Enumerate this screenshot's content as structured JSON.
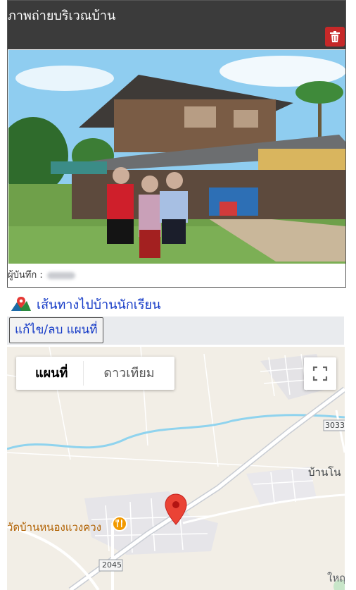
{
  "panel": {
    "title": "ภาพถ่ายบริเวณบ้าน",
    "delete_icon": "trash-icon",
    "recorder_label": "ผู้บันทึก :"
  },
  "route": {
    "icon": "map-pin-icon",
    "link_text": "เส้นทางไปบ้านนักเรียน"
  },
  "edit_map_button": "แก้ไข/ลบ แผนที่",
  "map": {
    "tabs": [
      {
        "label": "แผนที่",
        "active": true
      },
      {
        "label": "ดาวเทียม",
        "active": false
      }
    ],
    "fullscreen_icon": "fullscreen-icon",
    "road_badge_3033": "3033",
    "road_badge_2045": "2045",
    "village_label": "บ้านโน",
    "temple_label": "วัดบ้านหนองแวงควง",
    "partial_label": "ใหญ",
    "marker_icon": "location-marker-icon",
    "temple_icon": "restaurant-icon"
  },
  "colors": {
    "header_bg": "#3b3b3b",
    "delete_red": "#c62828",
    "link_blue": "#1238c6",
    "marker_red": "#ea4335",
    "temple_orange": "#f29900"
  }
}
